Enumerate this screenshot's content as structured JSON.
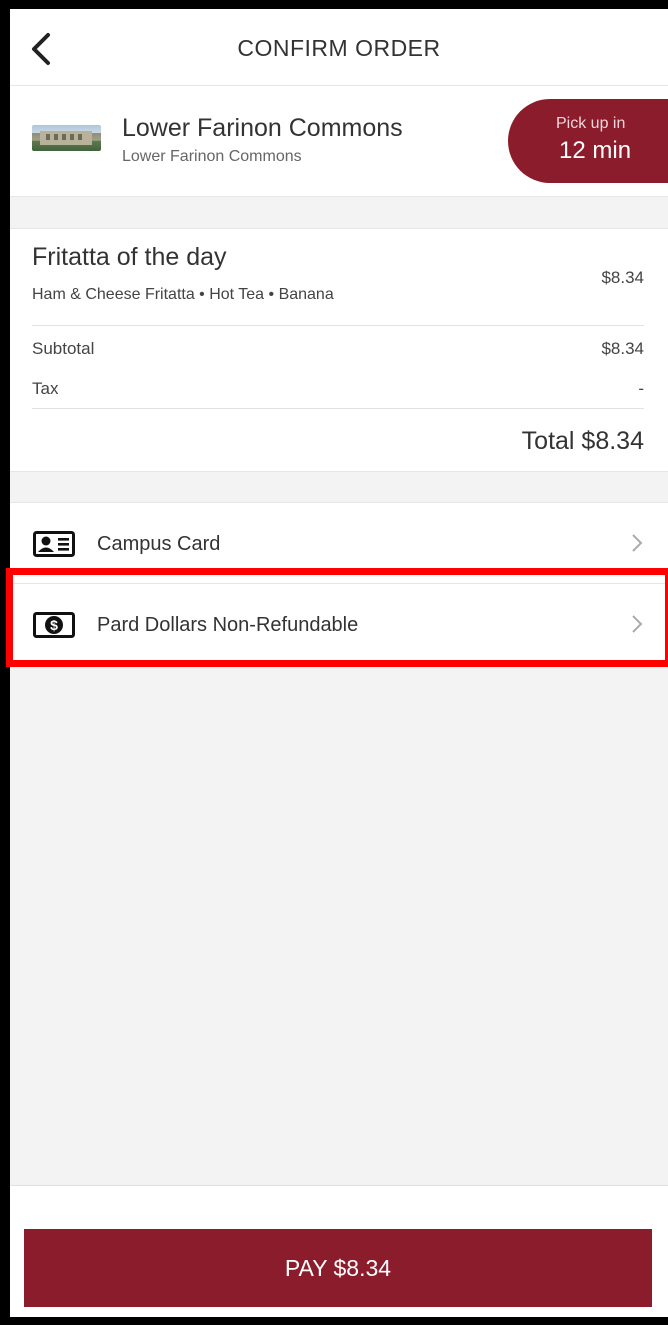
{
  "header": {
    "title": "CONFIRM ORDER"
  },
  "store": {
    "name": "Lower Farinon Commons",
    "subtitle": "Lower Farinon Commons",
    "pickup_label": "Pick up in",
    "pickup_time": "12 min"
  },
  "order": {
    "item_title": "Fritatta of the day",
    "item_desc": "Ham & Cheese Fritatta • Hot Tea • Banana",
    "item_price": "$8.34",
    "subtotal_label": "Subtotal",
    "subtotal_value": "$8.34",
    "tax_label": "Tax",
    "tax_value": "-",
    "total": "Total $8.34"
  },
  "payments": [
    {
      "label": "Campus Card",
      "icon": "id-card-icon"
    },
    {
      "label": "Pard Dollars Non-Refundable",
      "icon": "dollar-icon"
    }
  ],
  "pay_button": "PAY $8.34",
  "colors": {
    "brand": "#8b1c2b",
    "highlight": "#ff0000"
  }
}
